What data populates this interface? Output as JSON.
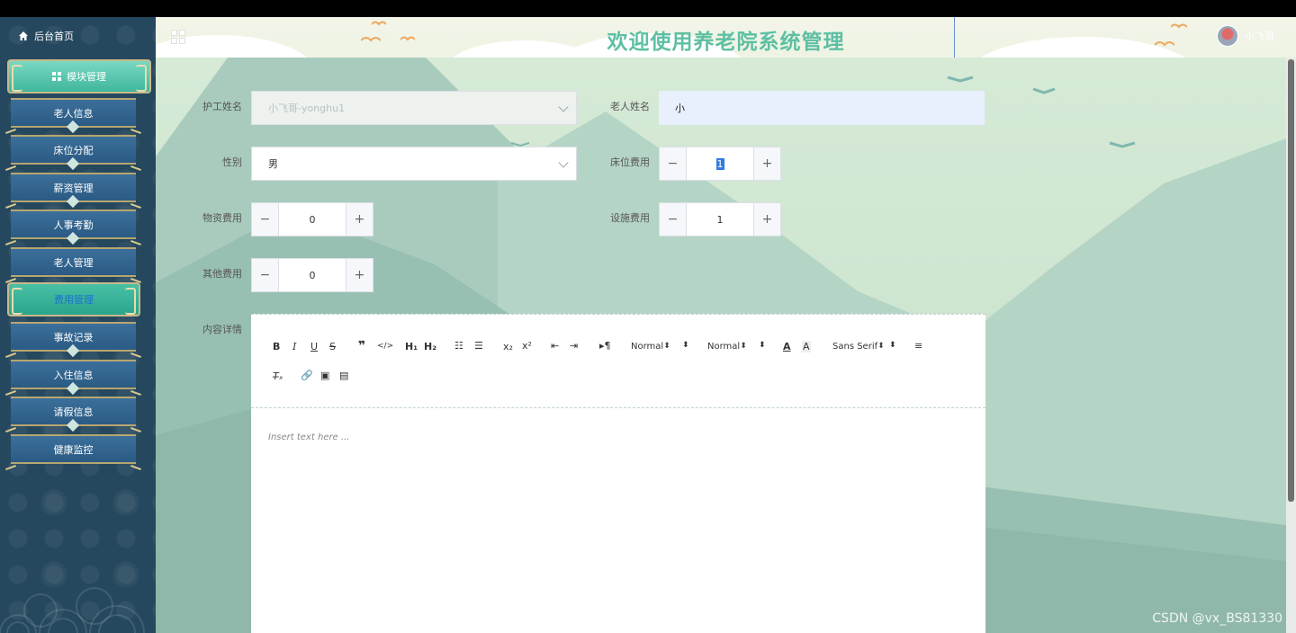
{
  "sidebar": {
    "home_label": "后台首页",
    "group_module": "模块管理",
    "group_fee": "费用管理",
    "items_a": [
      "老人信息",
      "床位分配",
      "薪资管理",
      "人事考勤",
      "老人管理"
    ],
    "items_b": [
      "事故记录",
      "入住信息",
      "请假信息",
      "健康监控"
    ]
  },
  "header": {
    "title": "欢迎使用养老院系统管理",
    "user_name": "小飞哥"
  },
  "form": {
    "nurse_label": "护工姓名",
    "nurse_value": "小飞哥-yonghu1",
    "elder_label": "老人姓名",
    "elder_value": "小",
    "gender_label": "性别",
    "gender_value": "男",
    "bed_fee_label": "床位费用",
    "bed_fee_value": "1",
    "material_fee_label": "物资费用",
    "material_fee_value": "0",
    "facility_fee_label": "设施费用",
    "facility_fee_value": "1",
    "other_fee_label": "其他费用",
    "other_fee_value": "0",
    "content_label": "内容详情"
  },
  "stepper": {
    "minus": "−",
    "plus": "+"
  },
  "editor": {
    "header_select": "Normal",
    "size_select": "Normal",
    "font_select": "Sans Serif",
    "placeholder": "Insert text here ..."
  },
  "watermark": "CSDN @vx_BS81330",
  "colors": {
    "accent": "#5dbfa3",
    "sidebar": "#25485e",
    "menu": "#2b5b84"
  }
}
